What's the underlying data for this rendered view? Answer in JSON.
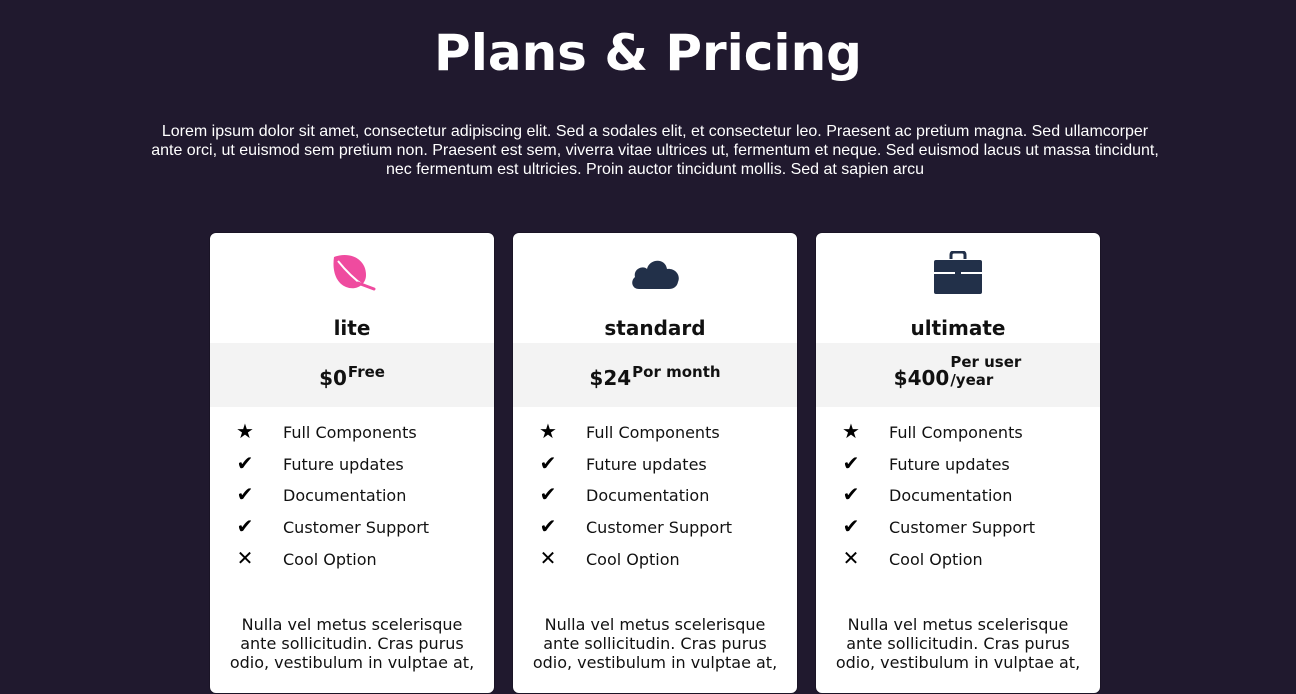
{
  "page": {
    "title": "Plans & Pricing",
    "intro": "Lorem ipsum dolor sit amet, consectetur adipiscing elit. Sed a sodales elit, et consectetur leo. Praesent ac pretium magna. Sed ullamcorper ante orci, ut euismod sem pretium non. Praesent est sem, viverra vitae ultrices ut, fermentum et neque. Sed euismod lacus ut massa tincidunt, nec fermentum est ultricies. Proin auctor tincidunt mollis. Sed at sapien arcu"
  },
  "colors": {
    "background": "#20192e",
    "card": "#ffffff",
    "price_band": "#f3f3f3",
    "leaf_icon": "#ef4b9f",
    "dark_icon": "#223049"
  },
  "plans": [
    {
      "icon": "leaf-icon",
      "name": "lite",
      "price": "$0",
      "period": "Free",
      "features": [
        {
          "icon": "star-icon",
          "label": "Full Components"
        },
        {
          "icon": "check-icon",
          "label": "Future updates"
        },
        {
          "icon": "check-icon",
          "label": "Documentation"
        },
        {
          "icon": "check-icon",
          "label": "Customer Support"
        },
        {
          "icon": "cross-icon",
          "label": "Cool Option"
        }
      ],
      "description": "Nulla vel metus scelerisque ante sollicitudin. Cras purus odio, vestibulum in vulptae at,"
    },
    {
      "icon": "cloud-icon",
      "name": "standard",
      "price": "$24",
      "period": "Por month",
      "features": [
        {
          "icon": "star-icon",
          "label": "Full Components"
        },
        {
          "icon": "check-icon",
          "label": "Future updates"
        },
        {
          "icon": "check-icon",
          "label": "Documentation"
        },
        {
          "icon": "check-icon",
          "label": "Customer Support"
        },
        {
          "icon": "cross-icon",
          "label": "Cool Option"
        }
      ],
      "description": "Nulla vel metus scelerisque ante sollicitudin. Cras purus odio, vestibulum in vulptae at,"
    },
    {
      "icon": "briefcase-icon",
      "name": "ultimate",
      "price": "$400",
      "period": "Per user /year",
      "features": [
        {
          "icon": "star-icon",
          "label": "Full Components"
        },
        {
          "icon": "check-icon",
          "label": "Future updates"
        },
        {
          "icon": "check-icon",
          "label": "Documentation"
        },
        {
          "icon": "check-icon",
          "label": "Customer Support"
        },
        {
          "icon": "cross-icon",
          "label": "Cool Option"
        }
      ],
      "description": "Nulla vel metus scelerisque ante sollicitudin. Cras purus odio, vestibulum in vulptae at,"
    }
  ]
}
